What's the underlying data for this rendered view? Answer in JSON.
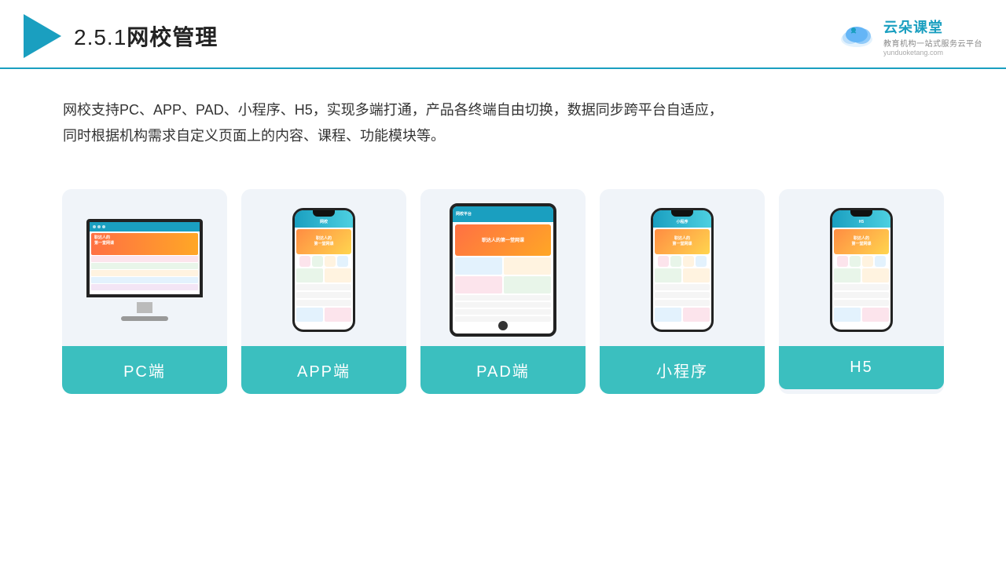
{
  "header": {
    "section_number": "2.5.1",
    "title": "网校管理",
    "logo_alt": "云朵课堂 logo"
  },
  "brand": {
    "name": "云朵课堂",
    "url": "yunduoketang.com",
    "tagline": "教育机构一站",
    "tagline2": "式服务云平台"
  },
  "description": {
    "text": "网校支持PC、APP、PAD、小程序、H5，实现多端打通，产品各终端自由切换，数据同步跨平台自适应，同时根据机构需求自定义页面上的内容、课程、功能模块等。"
  },
  "cards": [
    {
      "label": "PC端",
      "type": "pc"
    },
    {
      "label": "APP端",
      "type": "phone"
    },
    {
      "label": "PAD端",
      "type": "tablet"
    },
    {
      "label": "小程序",
      "type": "phone"
    },
    {
      "label": "H5",
      "type": "phone"
    }
  ],
  "colors": {
    "teal": "#3bbfbf",
    "header_line": "#1a9fc0",
    "bg_card": "#f0f4f9",
    "text_dark": "#222",
    "text_body": "#333"
  }
}
